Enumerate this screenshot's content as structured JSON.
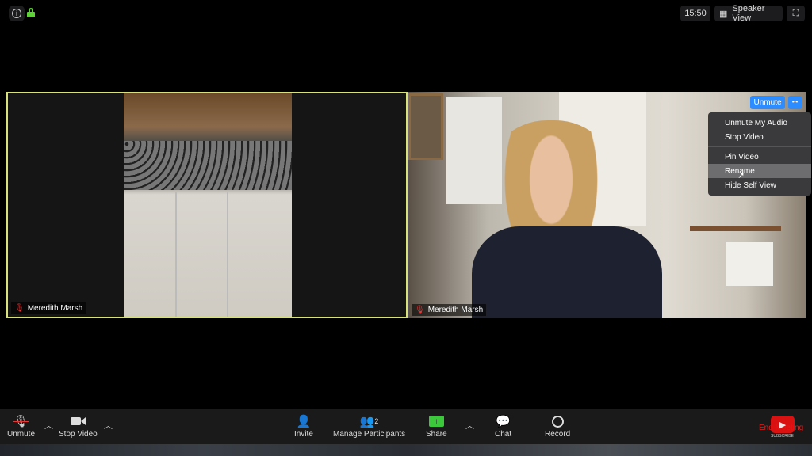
{
  "topbar": {
    "info_icon": "info-icon",
    "lock_icon": "lock-icon",
    "time": "15:50",
    "view_label": "Speaker View",
    "fullscreen_icon": "fullscreen-icon"
  },
  "videos": [
    {
      "name": "Meredith Marsh",
      "active": true,
      "border_color": "#d9e27a"
    },
    {
      "name": "Meredith Marsh"
    }
  ],
  "overlay": {
    "unmute_label": "Unmute",
    "more_label": "•••",
    "accent": "#2d8cff"
  },
  "context_menu": {
    "items": [
      "Unmute My Audio",
      "Stop Video",
      "Pin Video",
      "Rename",
      "Hide Self View"
    ],
    "highlighted": "Rename"
  },
  "toolbar": {
    "unmute": "Unmute",
    "stop_video": "Stop Video",
    "invite": "Invite",
    "participants": "Manage Participants",
    "participant_count": "2",
    "share": "Share",
    "chat": "Chat",
    "record": "Record",
    "end": "End Meeting",
    "share_color": "#3bc83b"
  },
  "watermark": {
    "subscribe": "SUBSCRIBE"
  }
}
